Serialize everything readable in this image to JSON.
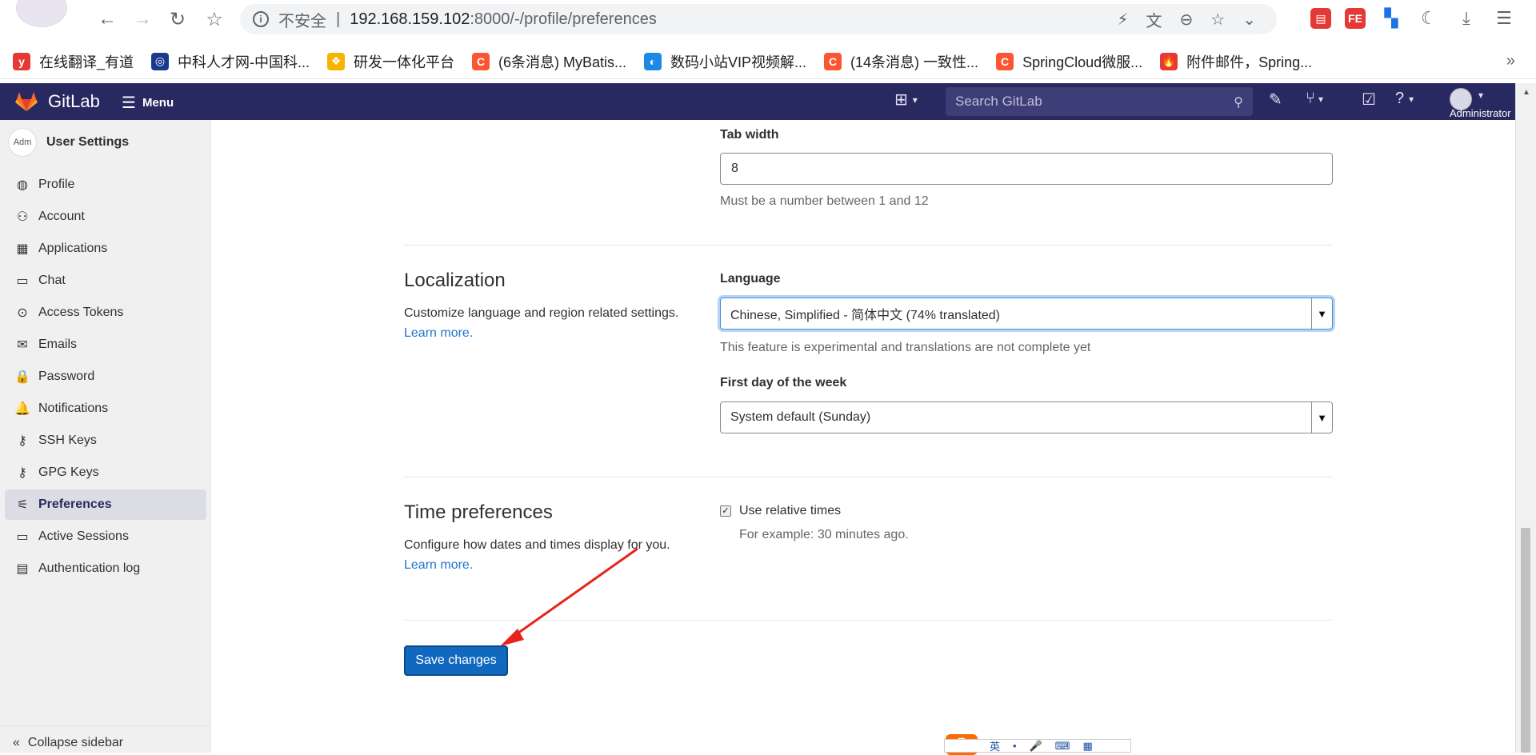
{
  "browser": {
    "address_insecure": "不安全",
    "address_separator": "|",
    "address_host": "192.168.159.102",
    "address_path": ":8000/-/profile/preferences",
    "bookmarks": [
      {
        "label": "在线翻译_有道",
        "icon_color": "#e53935",
        "glyph": "y"
      },
      {
        "label": "中科人才网-中国科...",
        "icon_color": "#1a3a8f",
        "glyph": "◎"
      },
      {
        "label": "研发一体化平台",
        "icon_color": "#f4b400",
        "glyph": "❖"
      },
      {
        "label": "(6条消息) MyBatis...",
        "icon_color": "#fc5531",
        "glyph": "C"
      },
      {
        "label": "数码小站VIP视频解...",
        "icon_color": "#1e88e5",
        "glyph": "◐"
      },
      {
        "label": "(14条消息) 一致性...",
        "icon_color": "#fc5531",
        "glyph": "C"
      },
      {
        "label": "SpringCloud微服...",
        "icon_color": "#fc5531",
        "glyph": "C"
      },
      {
        "label": "附件邮件，Spring...",
        "icon_color": "#e53935",
        "glyph": "🔥"
      }
    ],
    "more": "»"
  },
  "header": {
    "brand": "GitLab",
    "menu_label": "Menu",
    "search_placeholder": "Search GitLab",
    "admin_label": "Administrator"
  },
  "sidebar": {
    "title": "User Settings",
    "avatar_alt": "Adm",
    "items": [
      {
        "label": "Profile",
        "icon": "◍"
      },
      {
        "label": "Account",
        "icon": "⚇"
      },
      {
        "label": "Applications",
        "icon": "▦"
      },
      {
        "label": "Chat",
        "icon": "▭"
      },
      {
        "label": "Access Tokens",
        "icon": "⊙"
      },
      {
        "label": "Emails",
        "icon": "✉"
      },
      {
        "label": "Password",
        "icon": "🔒"
      },
      {
        "label": "Notifications",
        "icon": "🔔"
      },
      {
        "label": "SSH Keys",
        "icon": "⚷"
      },
      {
        "label": "GPG Keys",
        "icon": "⚷"
      },
      {
        "label": "Preferences",
        "icon": "⚟"
      },
      {
        "label": "Active Sessions",
        "icon": "▭"
      },
      {
        "label": "Authentication log",
        "icon": "▤"
      }
    ],
    "active": "Preferences",
    "collapse_label": "Collapse sidebar"
  },
  "tab_width": {
    "label": "Tab width",
    "value": "8",
    "help": "Must be a number between 1 and 12"
  },
  "localization": {
    "title": "Localization",
    "description": "Customize language and region related settings.",
    "learn_more": "Learn more.",
    "language_label": "Language",
    "language_value": "Chinese, Simplified - 简体中文 (74% translated)",
    "language_help": "This feature is experimental and translations are not complete yet",
    "first_day_label": "First day of the week",
    "first_day_value": "System default (Sunday)"
  },
  "time_preferences": {
    "title": "Time preferences",
    "description": "Configure how dates and times display for you.",
    "learn_more": "Learn more.",
    "relative_times_label": "Use relative times",
    "relative_times_checked": true,
    "relative_times_help": "For example: 30 minutes ago."
  },
  "save_button": "Save changes",
  "colors": {
    "header_bg": "#292961",
    "primary_button": "#1068bf",
    "link": "#1f75cb",
    "annotation_arrow": "#e8231b"
  }
}
